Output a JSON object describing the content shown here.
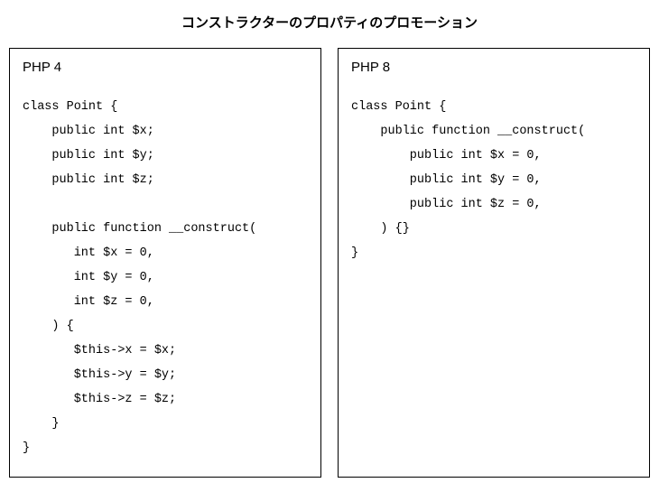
{
  "title": "コンストラクターのプロパティのプロモーション",
  "left": {
    "header": "PHP 4",
    "code": "class Point {\n    public int $x;\n    public int $y;\n    public int $z;\n\n    public function __construct(\n       int $x = 0,\n       int $y = 0,\n       int $z = 0,\n    ) {\n       $this->x = $x;\n       $this->y = $y;\n       $this->z = $z;\n    }\n}"
  },
  "right": {
    "header": "PHP 8",
    "code": "class Point {\n    public function __construct(\n        public int $x = 0,\n        public int $y = 0,\n        public int $z = 0,\n    ) {}\n}"
  }
}
